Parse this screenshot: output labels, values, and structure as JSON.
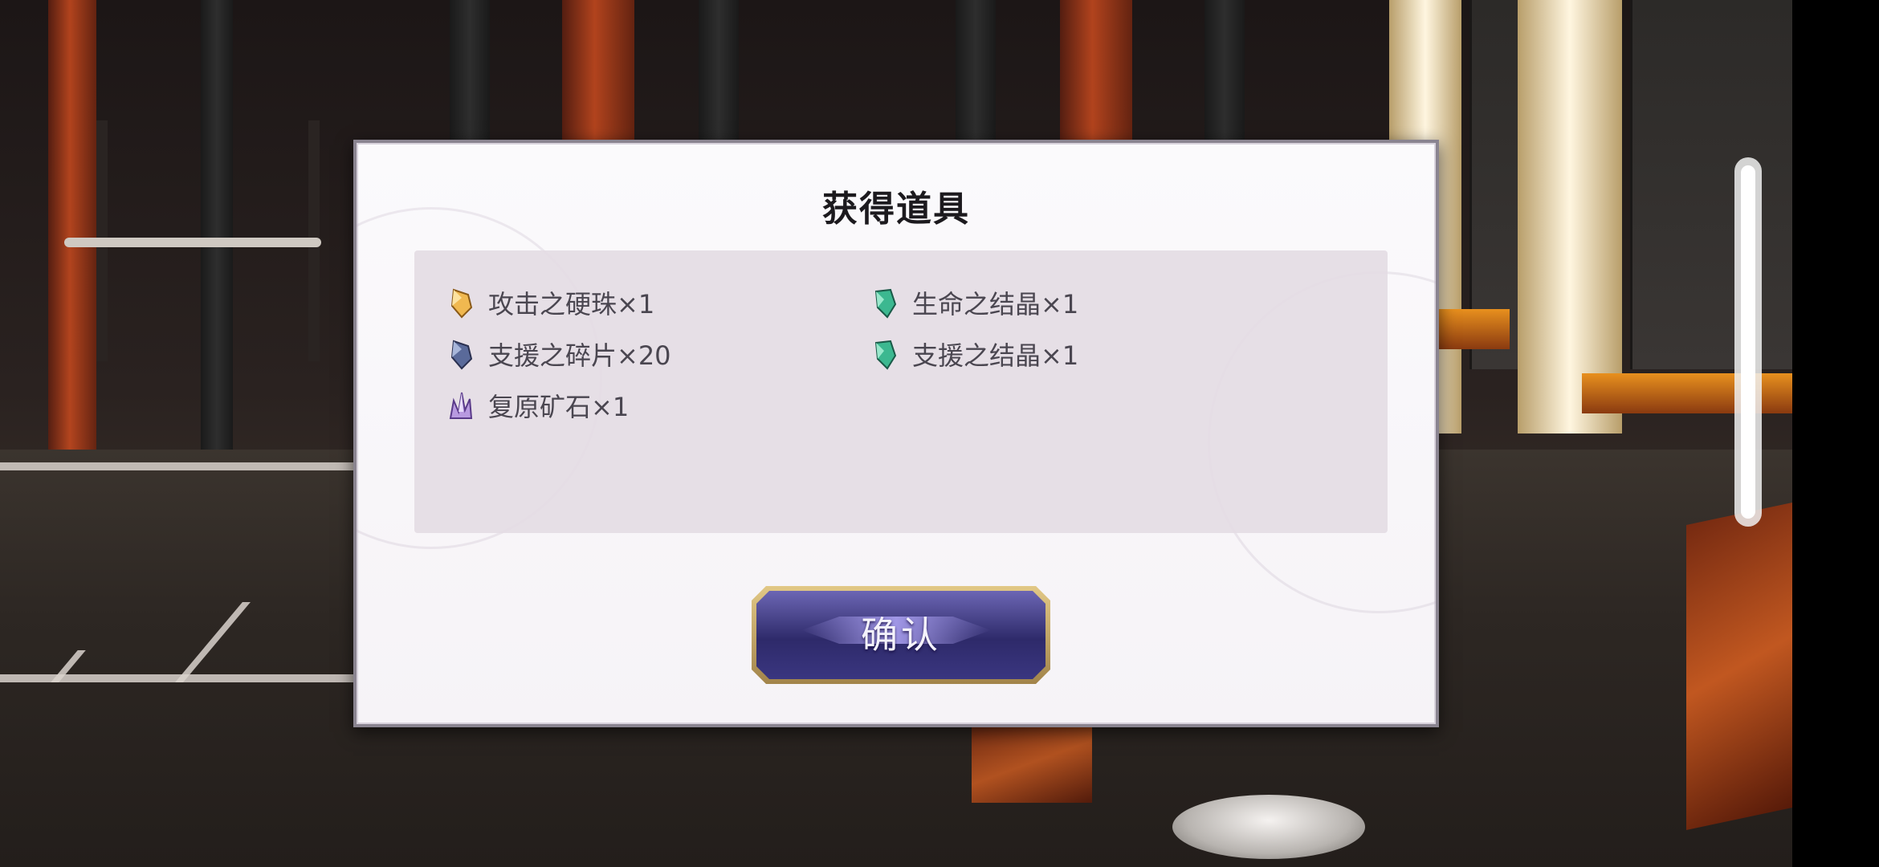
{
  "dialog": {
    "title": "获得道具",
    "items": [
      {
        "label": "攻击之硬珠×1",
        "icon": "amber-gem-icon",
        "color": "#e0a040"
      },
      {
        "label": "生命之结晶×1",
        "icon": "green-crystal-icon",
        "color": "#3ab08a"
      },
      {
        "label": "支援之碎片×20",
        "icon": "blue-gem-icon",
        "color": "#5a6a9a"
      },
      {
        "label": "支援之结晶×1",
        "icon": "green-crystal-icon",
        "color": "#3ab08a"
      },
      {
        "label": "复原矿石×1",
        "icon": "purple-ore-icon",
        "color": "#a080d0"
      }
    ],
    "confirm_label": "确认"
  },
  "colors": {
    "dialog_bg": "#f8f6f9",
    "panel_bg": "#e4dce4",
    "button_gold": "#d4b878",
    "button_purple": "#3a3680"
  }
}
